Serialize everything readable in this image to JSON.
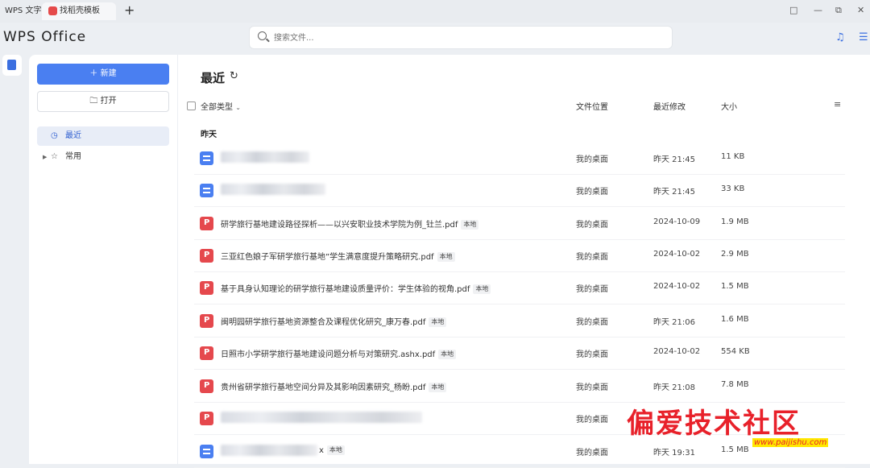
{
  "tabbar": {
    "home_tab": "WPS 文字",
    "doc_tab": "找稻壳模板",
    "add_tab": "+",
    "controls": [
      "□",
      "—",
      "⧉",
      "✕"
    ]
  },
  "header": {
    "logo": "WPS Office",
    "search_placeholder": "搜索文件..."
  },
  "sidebar": {
    "new_label": "新建",
    "open_label": "打开",
    "nav_recent": "最近",
    "nav_common": "常用"
  },
  "main": {
    "title": "最近",
    "filter_type": "全部类型",
    "col_location": "文件位置",
    "col_modified": "最近修改",
    "col_size": "大小",
    "group_label": "昨天",
    "local_tag": "本地",
    "files": [
      {
        "icon": "doc",
        "name": "",
        "tag": "",
        "location": "我的桌面",
        "modified": "昨天 21:45",
        "size": "11 KB"
      },
      {
        "icon": "doc",
        "name": "",
        "tag": "",
        "location": "我的桌面",
        "modified": "昨天 21:45",
        "size": "33 KB"
      },
      {
        "icon": "pdf",
        "name": "研学旅行基地建设路径探析——以兴安职业技术学院为例_钍兰.pdf",
        "tag": "本地",
        "location": "我的桌面",
        "modified": "2024-10-09",
        "size": "1.9 MB"
      },
      {
        "icon": "pdf",
        "name": "三亚红色娘子军研学旅行基地”学生满意度提升策略研究.pdf",
        "tag": "本地",
        "location": "我的桌面",
        "modified": "2024-10-02",
        "size": "2.9 MB"
      },
      {
        "icon": "pdf",
        "name": "基于具身认知理论的研学旅行基地建设质量评价：学生体验的视角.pdf",
        "tag": "本地",
        "location": "我的桌面",
        "modified": "2024-10-02",
        "size": "1.5 MB"
      },
      {
        "icon": "pdf",
        "name": "闽明园研学旅行基地资源整合及课程优化研究_康万春.pdf",
        "tag": "本地",
        "location": "我的桌面",
        "modified": "昨天 21:06",
        "size": "1.6 MB"
      },
      {
        "icon": "pdf",
        "name": "日照市小学研学旅行基地建设问题分析与对策研究.ashx.pdf",
        "tag": "本地",
        "location": "我的桌面",
        "modified": "2024-10-02",
        "size": "554 KB"
      },
      {
        "icon": "pdf",
        "name": "贵州省研学旅行基地空间分异及其影响因素研究_杨盼.pdf",
        "tag": "本地",
        "location": "我的桌面",
        "modified": "昨天 21:08",
        "size": "7.8 MB"
      },
      {
        "icon": "pdf",
        "name": "",
        "tag": "",
        "location": "我的桌面",
        "modified": "",
        "size": ""
      },
      {
        "icon": "doc",
        "name": "x",
        "tag": "本地",
        "location": "我的桌面",
        "modified": "昨天 19:31",
        "size": "1.5 MB"
      }
    ]
  },
  "watermark": {
    "text": "偏爱技术社区",
    "url": "www.paijishu.com"
  },
  "colors": {
    "accent": "#4a7ff1",
    "pdf": "#e5484d",
    "watermark": "#e8212a"
  }
}
